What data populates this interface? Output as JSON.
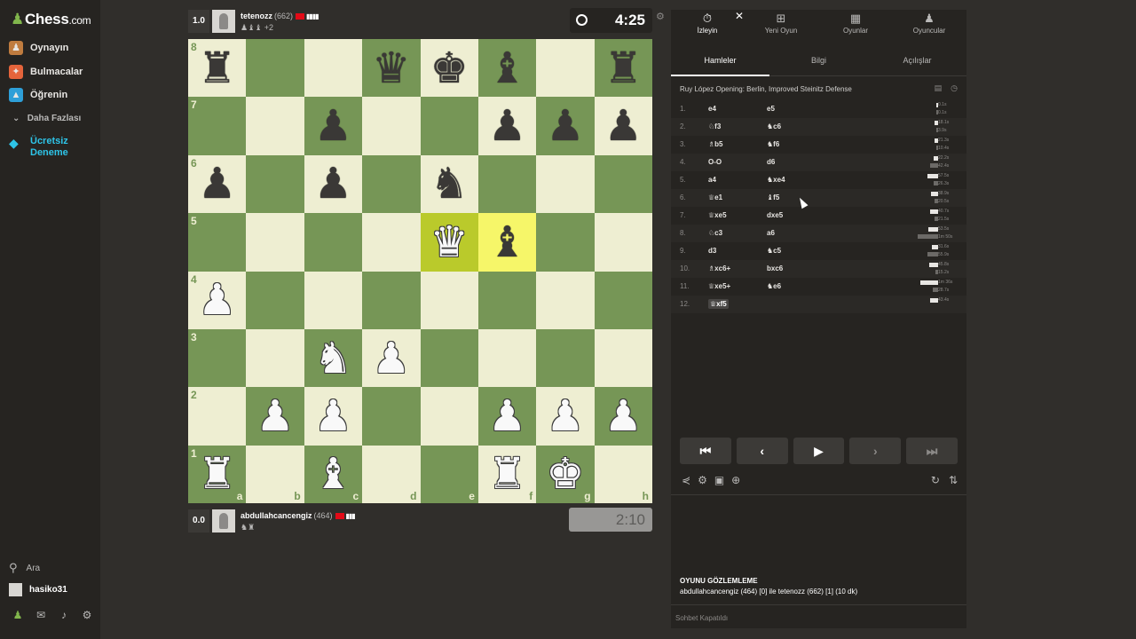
{
  "nav": {
    "logo": "Chess",
    "logo_suffix": ".com",
    "items": [
      {
        "label": "Oynayın",
        "icon": "play-icon",
        "color": "#c07c3f"
      },
      {
        "label": "Bulmacalar",
        "icon": "puzzle-icon",
        "color": "#e5643b"
      },
      {
        "label": "Öğrenin",
        "icon": "learn-icon",
        "color": "#2e9fd8"
      }
    ],
    "more": "Daha Fazlası",
    "free_trial": "Ücretsiz Deneme",
    "search": "Ara",
    "username": "hasiko31"
  },
  "players": {
    "top": {
      "score": "1.0",
      "name": "tetenozz",
      "rating": "(662)",
      "captured": "♟♝♝ +2"
    },
    "bottom": {
      "score": "0.0",
      "name": "abdullahcancengiz",
      "rating": "(464)",
      "captured": "♞♜"
    }
  },
  "clocks": {
    "top": "4:25",
    "bottom": "2:10"
  },
  "board": {
    "light": "#eeeed2",
    "dark": "#769656",
    "highlight": [
      "e5",
      "f5"
    ],
    "files": [
      "a",
      "b",
      "c",
      "d",
      "e",
      "f",
      "g",
      "h"
    ],
    "ranks": [
      "8",
      "7",
      "6",
      "5",
      "4",
      "3",
      "2",
      "1"
    ],
    "pieces": {
      "a8": "br",
      "d8": "bq",
      "e8": "bk",
      "f8": "bb",
      "h8": "br",
      "c7": "bp",
      "f7": "bp",
      "g7": "bp",
      "h7": "bp",
      "a6": "bp",
      "c6": "bp",
      "e6": "bn",
      "e5": "wq",
      "f5": "bb",
      "a4": "wp",
      "c3": "wn",
      "d3": "wp",
      "b2": "wp",
      "c2": "wp",
      "f2": "wp",
      "g2": "wp",
      "h2": "wp",
      "a1": "wr",
      "c1": "wb",
      "f1": "wr",
      "g1": "wk"
    }
  },
  "panel": {
    "top_tabs": [
      {
        "label": "İzleyin",
        "icon": "stopwatch-icon"
      },
      {
        "label": "Yeni Oyun",
        "icon": "plus-icon"
      },
      {
        "label": "Oyunlar",
        "icon": "board-icon"
      },
      {
        "label": "Oyuncular",
        "icon": "players-icon"
      }
    ],
    "sub_tabs": [
      "Hamleler",
      "Bilgi",
      "Açılışlar"
    ],
    "opening": "Ruy López Opening: Berlin, Improved Steinitz Defense",
    "moves": [
      {
        "n": "1.",
        "w": "e4",
        "b": "e5",
        "wt": "0.1s",
        "bt": "0.1s",
        "wf": 0.01,
        "bf": 0.01
      },
      {
        "n": "2.",
        "w": "♘f3",
        "b": "♞c6",
        "wt": "18.1s",
        "bt": "3.9s",
        "wf": 0.12,
        "bf": 0.03
      },
      {
        "n": "3.",
        "w": "♗b5",
        "b": "♞f6",
        "wt": "21.3s",
        "bt": "10.4s",
        "wf": 0.14,
        "bf": 0.07
      },
      {
        "n": "4.",
        "w": "O-O",
        "b": "d6",
        "wt": "22.2s",
        "bt": "42.4s",
        "wf": 0.15,
        "bf": 0.28
      },
      {
        "n": "5.",
        "w": "a4",
        "b": "♞xe4",
        "wt": "57.5s",
        "bt": "26.3s",
        "wf": 0.38,
        "bf": 0.17
      },
      {
        "n": "6.",
        "w": "♕e1",
        "b": "♝f5",
        "wt": "38.9s",
        "bt": "20.5s",
        "wf": 0.26,
        "bf": 0.14
      },
      {
        "n": "7.",
        "w": "♕xe5",
        "b": "dxe5",
        "wt": "40.7s",
        "bt": "21.5s",
        "wf": 0.27,
        "bf": 0.14
      },
      {
        "n": "8.",
        "w": "♘c3",
        "b": "a6",
        "wt": "53.5s",
        "bt": "1m 50s",
        "wf": 0.35,
        "bf": 0.73
      },
      {
        "n": "9.",
        "w": "d3",
        "b": "♞c5",
        "wt": "31.6s",
        "bt": "55.9s",
        "wf": 0.21,
        "bf": 0.37
      },
      {
        "n": "10.",
        "w": "♗xc6+",
        "b": "bxc6",
        "wt": "45.8s",
        "bt": "15.2s",
        "wf": 0.3,
        "bf": 0.1
      },
      {
        "n": "11.",
        "w": "♕xe5+",
        "b": "♞e6",
        "wt": "1m 36s",
        "bt": "28.7s",
        "wf": 0.64,
        "bf": 0.19
      },
      {
        "n": "12.",
        "w": "♕xf5",
        "b": "",
        "wt": "43.4s",
        "bt": "",
        "wf": 0.29,
        "bf": 0
      }
    ],
    "observing_title": "OYUNU GÖZLEMLEME",
    "observing_sub": "abdullahcancengiz (464) [0] ile tetenozz (662) [1] (10 dk)",
    "chat": "Sohbet Kapatıldı"
  }
}
